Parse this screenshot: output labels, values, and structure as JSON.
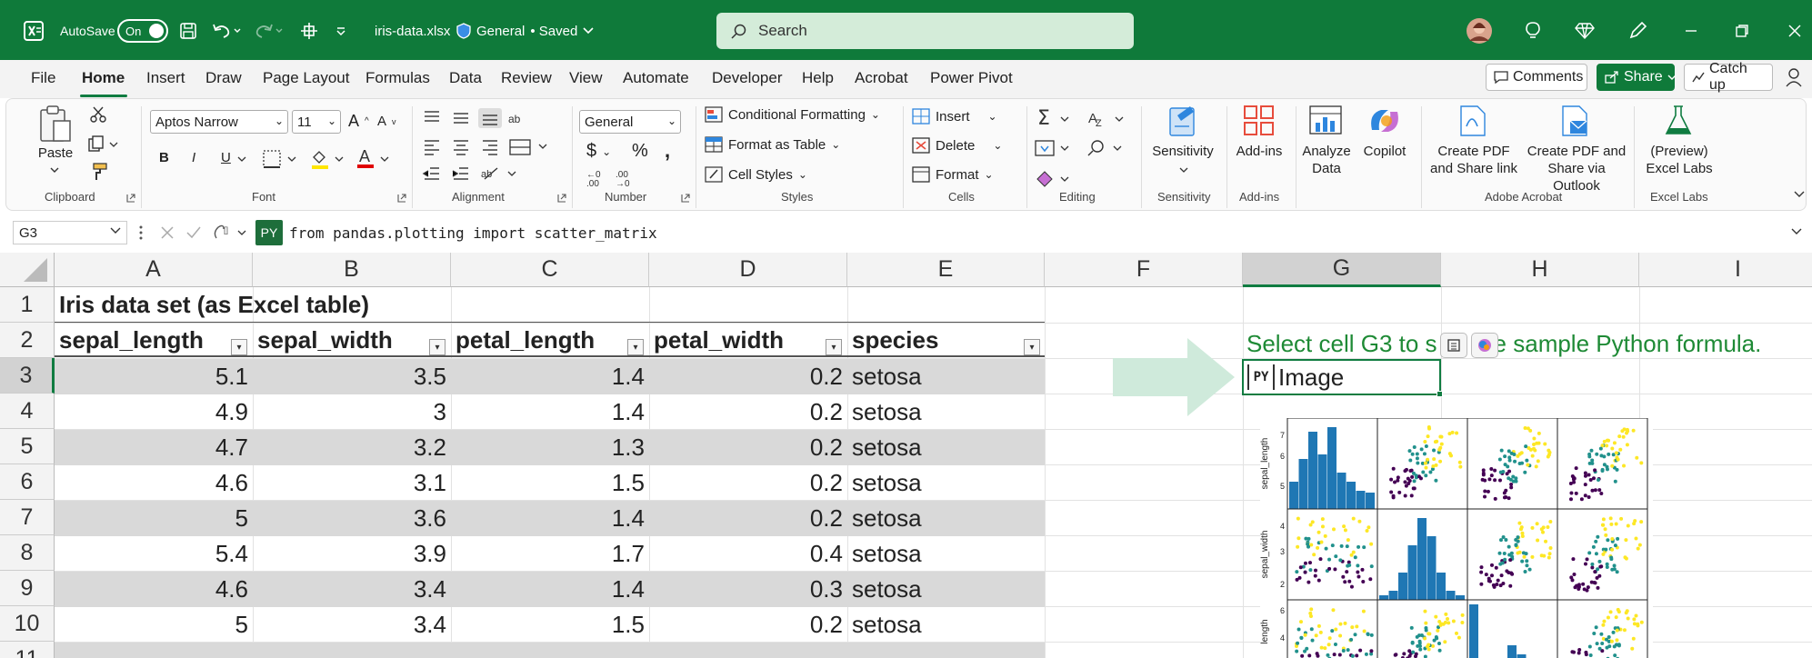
{
  "titlebar": {
    "autosave_label": "AutoSave",
    "autosave_state": "On",
    "file_name": "iris-data.xlsx",
    "sensitivity": "General",
    "save_status": "• Saved",
    "search_placeholder": "Search",
    "background_color": "#0f7a3a"
  },
  "menu": {
    "tabs": [
      "File",
      "Home",
      "Insert",
      "Draw",
      "Page Layout",
      "Formulas",
      "Data",
      "Review",
      "View",
      "Automate",
      "Developer",
      "Help",
      "Acrobat",
      "Power Pivot"
    ],
    "active_tab": "Home",
    "comments": "Comments",
    "share": "Share",
    "catch_up": "Catch up"
  },
  "ribbon": {
    "clipboard": {
      "label": "Clipboard",
      "paste": "Paste"
    },
    "font": {
      "label": "Font",
      "font_name": "Aptos Narrow",
      "font_size": "11",
      "bold": "B",
      "italic": "I",
      "underline": "U"
    },
    "alignment": {
      "label": "Alignment"
    },
    "number": {
      "label": "Number",
      "format": "General"
    },
    "styles": {
      "label": "Styles",
      "conditional": "Conditional Formatting",
      "format_table": "Format as Table",
      "cell_styles": "Cell Styles"
    },
    "cells": {
      "label": "Cells",
      "insert": "Insert",
      "delete": "Delete",
      "format": "Format"
    },
    "editing": {
      "label": "Editing"
    },
    "sensitivity": {
      "label": "Sensitivity",
      "button": "Sensitivity"
    },
    "addins": {
      "label": "Add-ins",
      "button": "Add-ins"
    },
    "analyze": "Analyze\nData",
    "copilot": "Copilot",
    "acrobat": {
      "label": "Adobe Acrobat",
      "create_pdf": "Create PDF\nand Share link",
      "create_pdf_outlook": "Create PDF and\nShare via Outlook"
    },
    "excel_labs": {
      "label": "Excel Labs",
      "button": "(Preview)\nExcel Labs"
    }
  },
  "formula_bar": {
    "name_box": "G3",
    "py_badge": "PY",
    "formula": "from pandas.plotting import scatter_matrix"
  },
  "sheet": {
    "columns": [
      "A",
      "B",
      "C",
      "D",
      "E",
      "F",
      "G",
      "H",
      "I"
    ],
    "selected_column": "G",
    "row_numbers": [
      "1",
      "2",
      "3",
      "4",
      "5",
      "6",
      "7",
      "8",
      "9",
      "10",
      "11"
    ],
    "selected_row": "3",
    "title": "Iris data set (as Excel table)",
    "headers": [
      "sepal_length",
      "sepal_width",
      "petal_length",
      "petal_width",
      "species"
    ],
    "rows": [
      [
        "5.1",
        "3.5",
        "1.4",
        "0.2",
        "setosa"
      ],
      [
        "4.9",
        "3",
        "1.4",
        "0.2",
        "setosa"
      ],
      [
        "4.7",
        "3.2",
        "1.3",
        "0.2",
        "setosa"
      ],
      [
        "4.6",
        "3.1",
        "1.5",
        "0.2",
        "setosa"
      ],
      [
        "5",
        "3.6",
        "1.4",
        "0.2",
        "setosa"
      ],
      [
        "5.4",
        "3.9",
        "1.7",
        "0.4",
        "setosa"
      ],
      [
        "4.6",
        "3.4",
        "1.4",
        "0.3",
        "setosa"
      ],
      [
        "5",
        "3.4",
        "1.5",
        "0.2",
        "setosa"
      ]
    ],
    "g2_text": "Select cell G3 to see the sample Python formula.",
    "g2_visible_text": "Select cell G3 to s",
    "g2_visible_tail": "e sample Python formula.",
    "g3_badge": "PY",
    "g3_value": "Image",
    "band_color": "#d9d9d9",
    "accent": "#107c41"
  },
  "scatter_matrix": {
    "axis_labels": [
      "sepal_length",
      "sepal_width",
      "length"
    ],
    "sepal_length_ticks": [
      "7",
      "6",
      "5"
    ],
    "sepal_width_ticks": [
      "4",
      "3",
      "2"
    ],
    "row3_ticks": [
      "6",
      "4"
    ],
    "colors": {
      "setosa": "#440154",
      "versicolor": "#21918c",
      "virginica": "#fde725",
      "hist": "#1f77b4"
    }
  }
}
